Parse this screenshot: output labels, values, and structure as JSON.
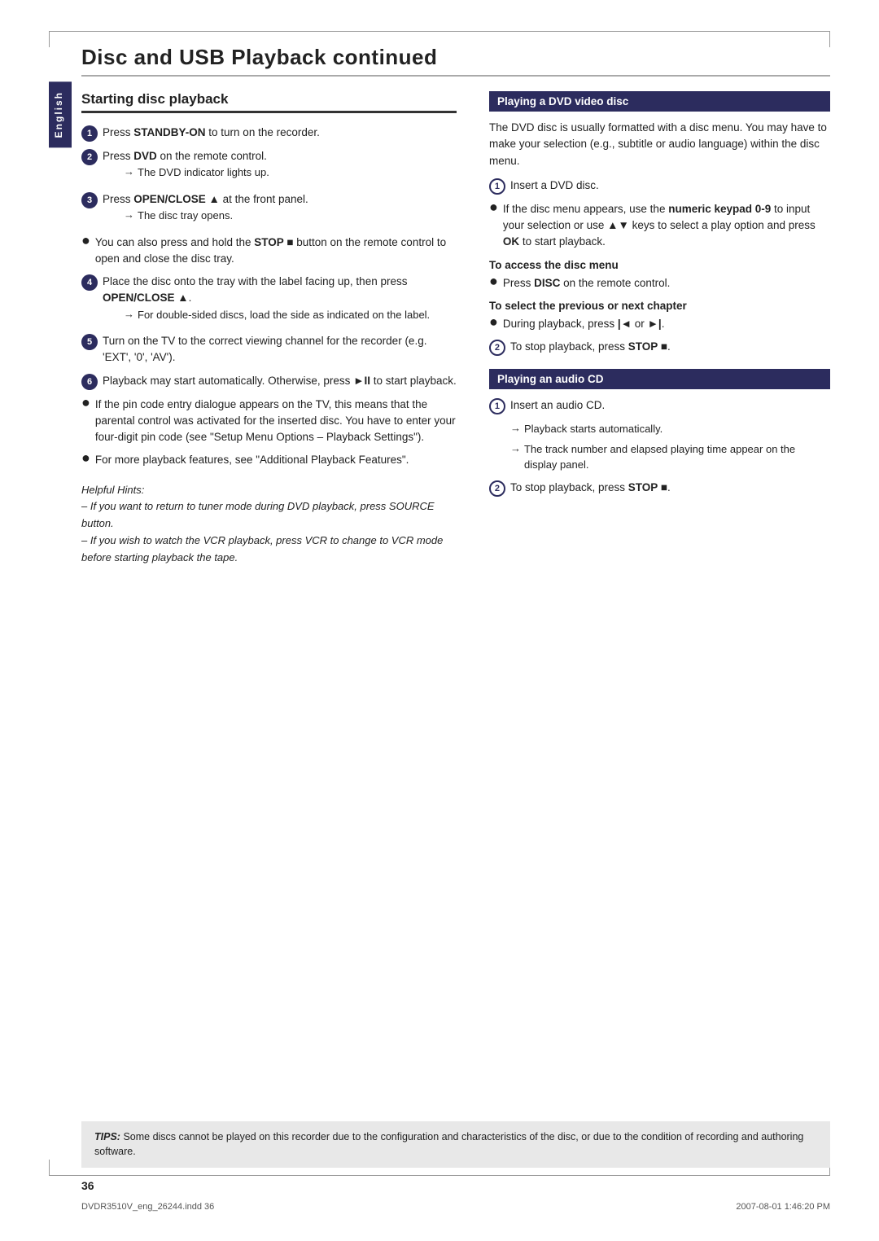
{
  "page": {
    "title": "Disc and USB Playback",
    "title_suffix": " continued",
    "language_tab": "English",
    "page_number": "36",
    "footer_left": "DVDR3510V_eng_26244.indd  36",
    "footer_right": "2007-08-01  1:46:20 PM"
  },
  "left_col": {
    "section_heading": "Starting disc playback",
    "steps": [
      {
        "num": "1",
        "text_html": "Press <b>STANDBY-ON</b> to turn on the recorder."
      },
      {
        "num": "2",
        "text_html": "Press <b>DVD</b> on the remote control.",
        "arrow": "The DVD indicator lights up."
      },
      {
        "num": "3",
        "text_html": "Press <b>OPEN/CLOSE ▲</b> at the front panel.",
        "arrow": "The disc tray opens."
      }
    ],
    "bullet1": {
      "text_html": "You can also press and hold the <b>STOP ■</b> button on the remote control to open and close the disc tray."
    },
    "step4": {
      "num": "4",
      "text_html": "Place the disc onto the tray with the label facing up, then press <b>OPEN/CLOSE ▲</b>.",
      "arrow": "For double-sided discs, load the side as indicated on the label."
    },
    "step5": {
      "num": "5",
      "text_html": "Turn on the TV to the correct viewing channel for the recorder (e.g. 'EXT', '0', 'AV')."
    },
    "step6": {
      "num": "6",
      "text_html": "Playback may start automatically. Otherwise, press <b>►II</b> to start playback."
    },
    "bullet2": {
      "text_html": "If the pin code entry dialogue appears on the TV, this means that the parental control was activated for the inserted disc. You have to enter your four-digit pin code (see \"Setup Menu Options – Playback Settings\")."
    },
    "bullet3": {
      "text_html": "For more playback features, see \"Additional Playback Features\"."
    },
    "hints": {
      "heading": "Helpful Hints:",
      "lines": [
        "– If you want to return to tuner mode during DVD playback, press SOURCE button.",
        "– If you wish to watch the VCR playback, press VCR to change to VCR mode before starting playback the tape."
      ]
    }
  },
  "right_col": {
    "dvd_section": {
      "heading": "Playing a DVD video disc",
      "intro": "The DVD disc is usually formatted with a disc menu. You may have to make your selection (e.g., subtitle or audio language) within the disc menu.",
      "step1": {
        "num": "1",
        "text": "Insert a DVD disc."
      },
      "bullet1": {
        "text_html": "If the disc menu appears, use the <b>numeric keypad 0-9</b> to input your selection or use <b>▲▼</b> keys to select a play option and press <b>OK</b> to start playback."
      },
      "disc_menu_heading": "To access the disc menu",
      "disc_menu_bullet": "Press <b>DISC</b> on the remote control.",
      "prev_next_heading": "To select the previous or next chapter",
      "prev_next_bullet": "During playback, press <b>|◄</b> or <b>►|</b>.",
      "step2": {
        "num": "2",
        "text_html": "To stop playback, press <b>STOP ■</b>."
      }
    },
    "audio_cd_section": {
      "heading": "Playing an audio CD",
      "step1": {
        "num": "1",
        "text": "Insert an audio CD."
      },
      "arrow1": "Playback starts automatically.",
      "arrow2": "The track number and elapsed playing time appear on the display panel.",
      "step2": {
        "num": "2",
        "text_html": "To stop playback, press <b>STOP ■</b>."
      }
    }
  },
  "tips_box": {
    "label": "TIPS:",
    "text": "Some discs cannot be played on this recorder due to the configuration and characteristics of the disc, or due to the condition of recording and authoring software."
  }
}
